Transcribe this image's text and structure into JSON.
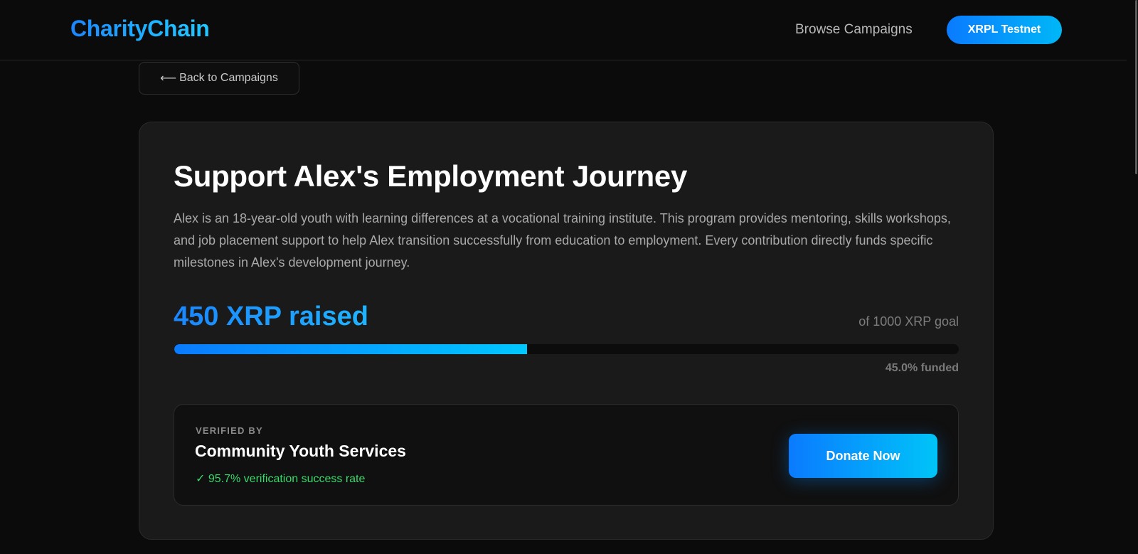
{
  "header": {
    "logo": "CharityChain",
    "nav_link": "Browse Campaigns",
    "network_badge": "XRPL Testnet"
  },
  "back_button": {
    "arrow": "⟵",
    "label": "Back to Campaigns"
  },
  "campaign": {
    "title": "Support Alex's Employment Journey",
    "description": "Alex is an 18-year-old youth with learning differences at a vocational training institute. This program provides mentoring, skills workshops, and job placement support to help Alex transition successfully from education to employment. Every contribution directly funds specific milestones in Alex's development journey.",
    "raised_text": "450 XRP raised",
    "goal_text": "of 1000 XRP goal",
    "progress_fraction": 0.45,
    "funded_text": "45.0% funded"
  },
  "verifier": {
    "label": "VERIFIED BY",
    "name": "Community Youth Services",
    "rate": "✓ 95.7% verification success rate",
    "donate_label": "Donate Now"
  },
  "colors": {
    "accent_start": "#0a7bff",
    "accent_end": "#00c4f8",
    "success": "#39d96c",
    "background": "#0b0b0b",
    "card": "#1a1a1a"
  }
}
